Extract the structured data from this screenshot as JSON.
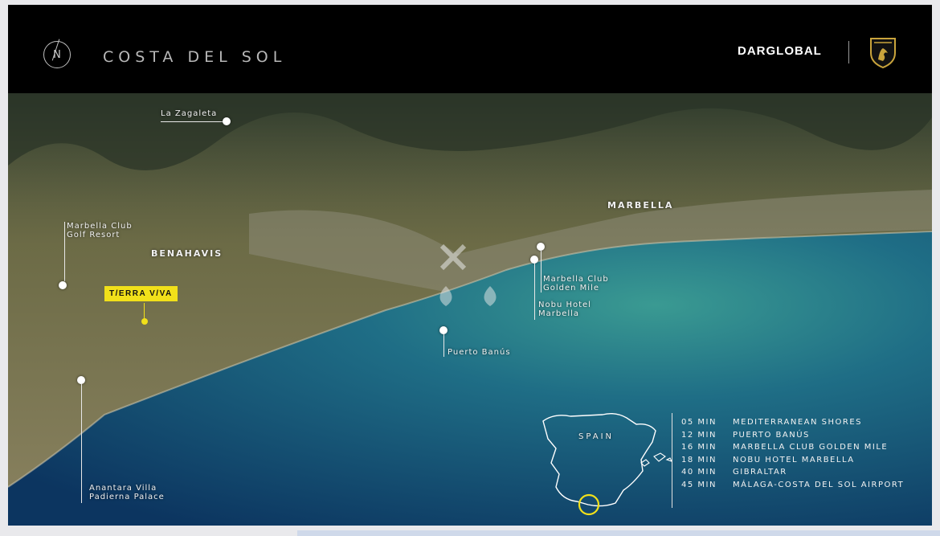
{
  "header": {
    "north_letter": "N",
    "title": "COSTA DEL SOL",
    "brand": "DARGLOBAL",
    "crest_icon": "lamborghini-crest-icon"
  },
  "map": {
    "places": {
      "la_zagaleta": "La Zagaleta",
      "marbella": "MARBELLA",
      "benahavis": "BENAHAVIS",
      "marbella_club_golf_1": "Marbella Club",
      "marbella_club_golf_2": "Golf Resort",
      "project": "T/ERRA V/VA",
      "marbella_club_golden_1": "Marbella Club",
      "marbella_club_golden_2": "Golden Mile",
      "nobu_1": "Nobu Hotel",
      "nobu_2": "Marbella",
      "puerto_banus": "Puerto Banús",
      "anantara_1": "Anantara Villa",
      "anantara_2": "Padierna Palace"
    },
    "inset": {
      "country": "SPAIN"
    },
    "travel_times": [
      {
        "time": "05 MIN",
        "place": "MEDITERRANEAN SHORES"
      },
      {
        "time": "12 MIN",
        "place": "PUERTO BANÚS"
      },
      {
        "time": "16 MIN",
        "place": "MARBELLA CLUB GOLDEN MILE"
      },
      {
        "time": "18 MIN",
        "place": "NOBU HOTEL MARBELLA"
      },
      {
        "time": "40 MIN",
        "place": "GIBRALTAR"
      },
      {
        "time": "45 MIN",
        "place": "MÁLAGA-COSTA DEL SOL AIRPORT"
      }
    ],
    "colors": {
      "highlight": "#f1e01a",
      "sea_deep": "#0f3f6b",
      "sea_shallow": "#2b8a8a",
      "land": "#6b6a45"
    }
  }
}
